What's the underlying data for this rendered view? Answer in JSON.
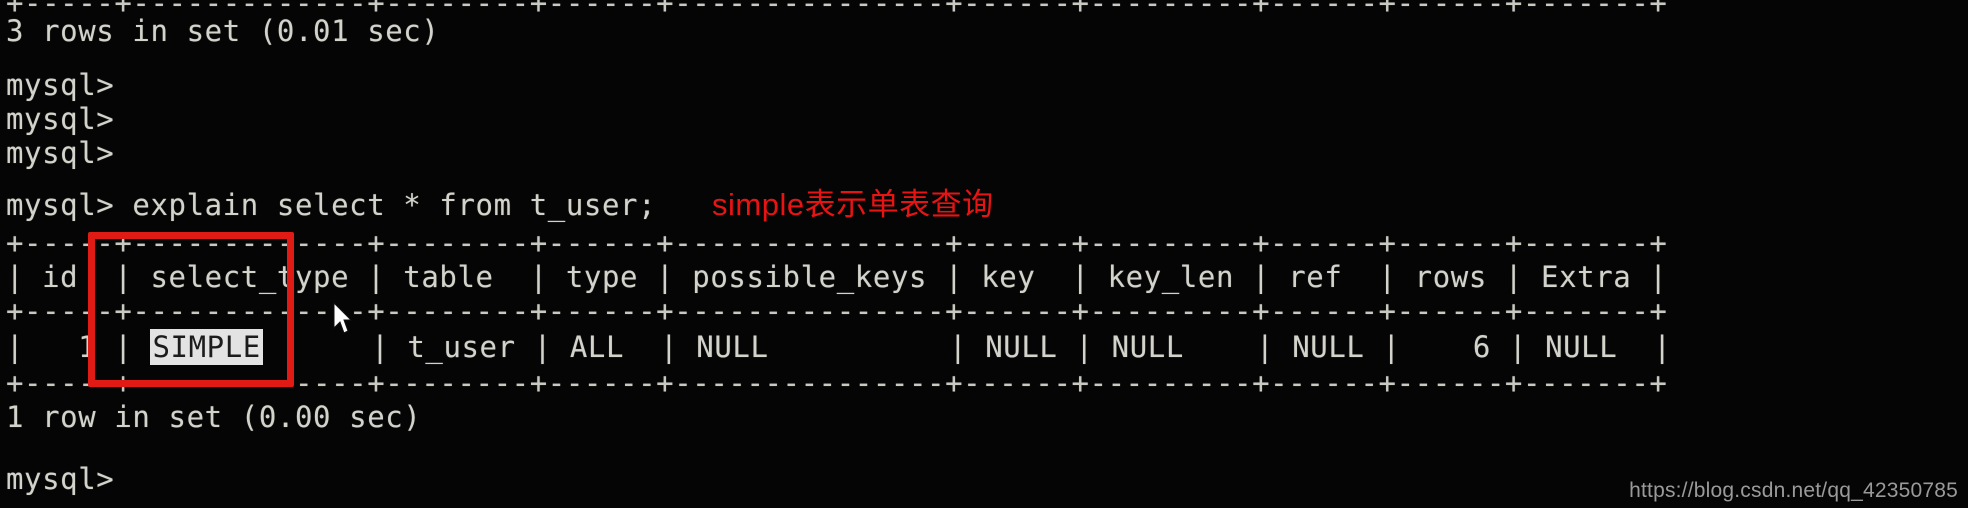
{
  "terminal": {
    "background_color": "#050505",
    "text_color": "#d3d3cc",
    "prompt": "mysql>",
    "lines": [
      "+-----+-------------+--------+------+---------------+------+---------+------+------+-------+",
      "3 rows in set (0.01 sec)",
      "",
      "mysql>",
      "mysql>",
      "mysql>",
      "mysql> explain select * from t_user;",
      "+-----+-------------+--------+------+---------------+------+---------+------+------+-------+",
      "| id  | select_type | table  | type | possible_keys | key  | key_len | ref  | rows | Extra |",
      "+-----+-------------+--------+------+---------------+------+---------+------+------+-------+",
      "|   1 | SIMPLE      | t_user | ALL  | NULL          | NULL | NULL    | NULL |    6 | NULL  |",
      "+-----+-------------+--------+------+---------------+------+---------+------+------+-------+",
      "1 row in set (0.00 sec)",
      "",
      "mysql>"
    ],
    "top_rule": "+-----+-------------+--------+------+---------------+------+---------+------+------+-------+",
    "result_count_top": "3 rows in set (0.01 sec)",
    "command": "mysql> explain select * from t_user;",
    "result_count_bottom": "1 row in set (0.00 sec)",
    "final_prompt": "mysql>"
  },
  "explain_table": {
    "rule": "+-----+-------------+--------+------+---------------+------+---------+------+------+-------+",
    "header_text": "| id  | select_type | table  | type | possible_keys | key  | key_len | ref  | rows | Extra |",
    "columns": [
      "id",
      "select_type",
      "table",
      "type",
      "possible_keys",
      "key",
      "key_len",
      "ref",
      "rows",
      "Extra"
    ],
    "rows": [
      {
        "id": "1",
        "select_type": "SIMPLE",
        "table": "t_user",
        "type": "ALL",
        "possible_keys": "NULL",
        "key": "NULL",
        "key_len": "NULL",
        "ref": "NULL",
        "rows": "6",
        "Extra": "NULL"
      }
    ],
    "row_prefix": "|   1 | ",
    "row_suffix": "      | t_user | ALL  | NULL          | NULL | NULL    | NULL |    6 | NULL  |",
    "highlighted_value": "SIMPLE",
    "highlight_bg_color": "#e3e3e3",
    "highlight_fg_color": "#1c1c1c"
  },
  "annotation": {
    "text": "simple表示单表查询",
    "color": "#e81313"
  },
  "highlight_box": {
    "target_column": "select_type",
    "stroke_color": "#e01b16"
  },
  "cursor": {
    "icon": "mouse-pointer-icon",
    "color": "#ffffff"
  },
  "watermark": {
    "text": "https://blog.csdn.net/qq_42350785",
    "color": "#9a9a9a"
  }
}
